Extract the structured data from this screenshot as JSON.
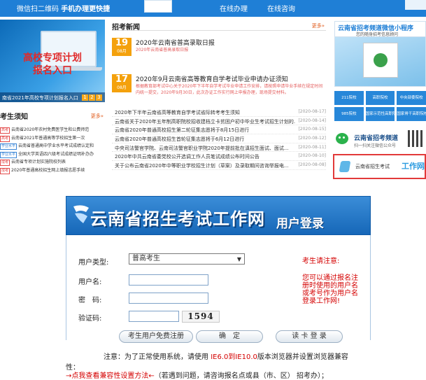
{
  "topbar": {
    "qr_prefix": "微信扫二维码",
    "qr_bold": "手机办理更快捷",
    "nav": [
      "在线办理",
      "在线咨询"
    ]
  },
  "banner": {
    "title_line1": "高校专项计划",
    "title_line2": "报名入口",
    "caption": "南省2021年高校专项计划报名入口",
    "pages": [
      "1",
      "2",
      "3"
    ]
  },
  "news": {
    "heading": "招考新闻",
    "more": "更多»",
    "featured": [
      {
        "day": "19",
        "month": "08月",
        "title": "2020年云南省普高录取日报",
        "summary": "2020年云南省普高录取日报"
      },
      {
        "day": "17",
        "month": "08月",
        "title": "2020年9月云南省高等教育自学考试毕业申请办证须知",
        "summary": "根据教育部考试中心关于2020年下半年自学考试毕业申请工作安排，请按照申请毕业手续在规定时间内统一提交，2020年9月30日，此次办证工作实行网上申报办理，现场提交材料。"
      }
    ],
    "items": [
      {
        "title": "2020年下半年云南省高等教育自学考试省际转考考生须知",
        "date": "[2020-08-17]"
      },
      {
        "title": "云南省关于2020年五年制高职院校招收建档立卡贫困户初中毕业生考试招生计划的...",
        "date": "[2020-08-14]"
      },
      {
        "title": "云南省2020年普通高校招生第二轮征集志愿将于8月15日进行",
        "date": "[2020-08-15]"
      },
      {
        "title": "云南省2020年普通高校招生首轮征集志愿将于6月12日进行",
        "date": "[2020-08-12]"
      },
      {
        "title": "中央司法警官学院、云南司法警官职业学院2020年提前批在滇招生面试、面试...",
        "date": "[2020-08-11]"
      },
      {
        "title": "2020年中共云南省委党校公开选调工作人员笔试成绩公布时间公告",
        "date": "[2020-08-10]"
      },
      {
        "title": "关于公布云南省2020年中等职业学校招生计划（草案）及录取期间咨询举报电...",
        "date": "[2020-08-08]"
      }
    ]
  },
  "notice": {
    "heading": "考生须知",
    "more": "更多»",
    "items": [
      {
        "tag": "高考",
        "text": "云南省2020年农村免费医学生和公费师范",
        "blue": false
      },
      {
        "tag": "高考",
        "text": "云南省2021年普通高等学校招生第一次",
        "blue": false
      },
      {
        "tag": "学业水平",
        "text": "云南省普通高中学业水平考试成绩认定和",
        "blue": true
      },
      {
        "tag": "学业水平",
        "text": "全国大学英语四六级考试成绩证明补办办",
        "blue": true
      },
      {
        "tag": "成考",
        "text": "云南省专项计划实施院校列表",
        "blue": false
      },
      {
        "tag": "成考",
        "text": "2020年普通高校招生网上填报志愿手续",
        "blue": false
      }
    ]
  },
  "right": {
    "wechat_title": "云南省招考频道微信小程序",
    "wechat_sub": "您的随身招考信息顾问",
    "tiles": [
      "211院校",
      "高职院校",
      "中央部委院校",
      "985院校",
      "国家示范性高职院校",
      "国家骨干高职院校"
    ],
    "channel_name": "云南省招考频道",
    "channel_sub": "扫一扫关注微信公众号",
    "exam_small": "云南省招生考试",
    "exam_big": "工作网"
  },
  "login": {
    "site_name": "云南省招生考试工作网",
    "user_login": "用户登录",
    "labels": {
      "user_type": "用户类型:",
      "username": "用户名:",
      "password": "密　码:",
      "captcha": "验证码:"
    },
    "user_type_value": "普高考生",
    "captcha_value": "1594",
    "note_title": "考生请注意:",
    "note_body": "您可以通过报名注册时使用的用户名或考号作为用户名登录工作网!",
    "buttons": {
      "register": "考生用户免费注册",
      "confirm": "确　定",
      "card_login": "读 卡 登 录"
    },
    "footer1_pre": "注意：为了正常使用系统，请使用 ",
    "footer1_red": "IE6.0到IE10.0",
    "footer1_post": "版本浏览器并设置浏览器兼容",
    "footer2_pre": "性：",
    "footer3_link": "→点我查看兼容性设置方法←",
    "footer3_post": "（若遇到问题，请咨询报名点或县（市、区） 招考办）；"
  }
}
